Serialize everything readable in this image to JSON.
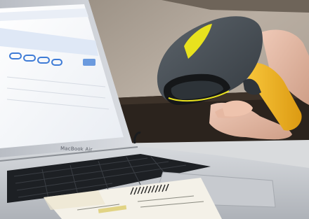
{
  "photo": {
    "laptop": {
      "brand_text": "MacBook Air"
    }
  },
  "colors": {
    "scanner_body": "#4a5158",
    "scanner_grip": "#f2b51a",
    "scanner_accent": "#e8e21e",
    "wall": "#b8aca0",
    "laptop_silver": "#c9ccd1",
    "screen": "#f4f6fa",
    "screen_blue": "#3e7bd6"
  },
  "icons": [
    "barcode-scanner-icon",
    "hand-icon",
    "laptop-icon",
    "label-icon"
  ]
}
